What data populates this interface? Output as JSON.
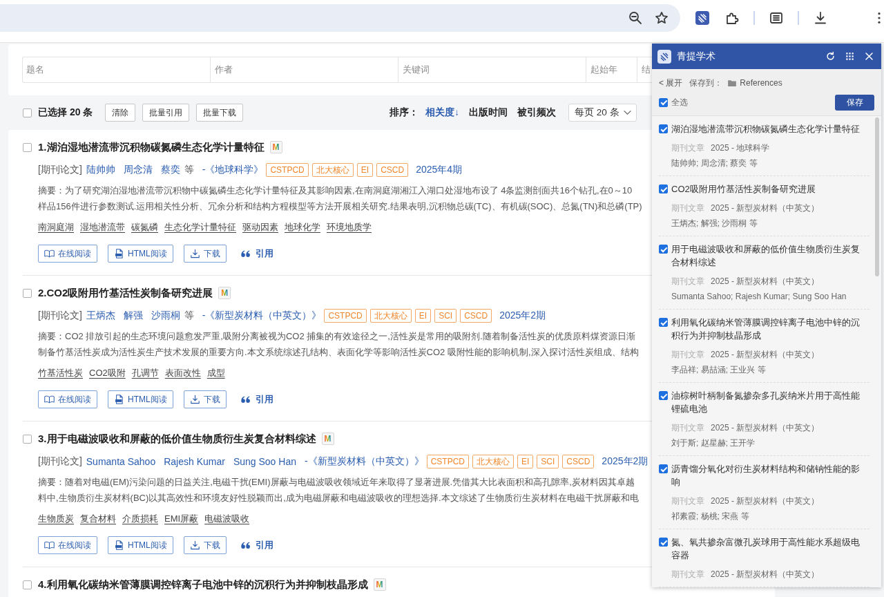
{
  "search_form": {
    "fields": [
      {
        "kind": "text",
        "placeholder": "题名"
      },
      {
        "kind": "text",
        "placeholder": "作者"
      },
      {
        "kind": "text",
        "placeholder": "关键词"
      },
      {
        "kind": "year",
        "placeholder": "起始年"
      },
      {
        "kind": "year",
        "placeholder": "结"
      }
    ]
  },
  "toolbar": {
    "select_all": {
      "checked": false,
      "label": "已选择 20 条"
    },
    "buttons": [
      "清除",
      "批量引用",
      "批量下载"
    ],
    "sort_label": "排序：",
    "sort_options": [
      {
        "label": "相关度↓",
        "selected": true
      },
      {
        "label": "出版时间",
        "selected": false
      },
      {
        "label": "被引频次",
        "selected": false
      }
    ],
    "page_size": "每页 20 条"
  },
  "results": [
    {
      "selected": false,
      "title": "1.湖泊湿地潜流带沉积物碳氮磷生态化学计量特征",
      "badge": "M",
      "type": "[期刊论文]",
      "authors": [
        "陆帅帅",
        "周念清",
        "蔡奕"
      ],
      "et_al": "等",
      "journal": "-《地球科学》",
      "tags": [
        "CSTPCD",
        "北大核心",
        "EI",
        "CSCD"
      ],
      "issue": "2025年4期",
      "abstract": [
        "摘要：为了研究湖泊湿地潜流带沉积物中碳氮磷生态化学计量特征及其影响因素,在南洞庭湖湘江入湖口处湿地布设了 4条监测剖面共16个钻孔,在0～10",
        "样品156件进行参数测试.运用相关性分析、冗余分析和结构方程模型等方法开展相关研究.结果表明,沉积物总碳(TC)、有机碳(SOC)、总氮(TN)和总磷(TP)"
      ],
      "keywords": [
        "南洞庭湖",
        "湿地潜流带",
        "碳氮磷",
        "生态化学计量特征",
        "驱动因素",
        "地球化学",
        "环境地质学"
      ],
      "actions": [
        {
          "kind": "read",
          "label": "在线阅读"
        },
        {
          "kind": "html",
          "label": "HTML阅读"
        },
        {
          "kind": "download",
          "label": "下载"
        },
        {
          "kind": "cite",
          "label": "引用"
        }
      ]
    },
    {
      "selected": false,
      "title": "2.CO2吸附用竹基活性炭制备研究进展",
      "badge": "M",
      "type": "[期刊论文]",
      "authors": [
        "王炳杰",
        "解强",
        "沙雨桐"
      ],
      "et_al": "等",
      "journal": "-《新型炭材料（中英文）》",
      "tags": [
        "CSTPCD",
        "北大核心",
        "EI",
        "SCI",
        "CSCD"
      ],
      "issue": "2025年2期",
      "abstract": [
        "摘要：CO2 排放引起的生态环境问题愈发严重,吸附分离被视为CO2 捕集的有效途径之一,活性炭是常用的吸附剂.随着制备活性炭的优质原料煤资源日渐",
        "制备竹基活性炭成为活性炭生产技术发展的重要方向.本文系统综述孔结构、表面化学等影响活性炭CO2 吸附性能的影响机制,深入探讨活性炭组成、结构"
      ],
      "keywords": [
        "竹基活性炭",
        "CO2吸附",
        "孔调节",
        "表面改性",
        "成型"
      ],
      "actions": [
        {
          "kind": "read",
          "label": "在线阅读"
        },
        {
          "kind": "html",
          "label": "HTML阅读"
        },
        {
          "kind": "download",
          "label": "下载"
        },
        {
          "kind": "cite",
          "label": "引用"
        }
      ]
    },
    {
      "selected": false,
      "title": "3.用于电磁波吸收和屏蔽的低价值生物质衍生炭复合材料综述",
      "badge": "M",
      "type": "[期刊论文]",
      "authors": [
        "Sumanta Sahoo",
        "Rajesh Kumar",
        "Sung Soo Han"
      ],
      "journal": "-《新型炭材料（中英文）》",
      "tags": [
        "CSTPCD",
        "北大核心",
        "EI",
        "SCI",
        "CSCD"
      ],
      "issue": "2025年2期",
      "abstract": [
        "摘要：随着对电磁(EM)污染问题的日益关注,电磁干扰(EMI)屏蔽与电磁波吸收领域近年来取得了显著进展.凭借其大比表面积和高孔隙率,炭材料因其卓越",
        "料中,生物质衍生炭材料(BC)以其高效性和环境友好性脱颖而出,成为电磁屏蔽和电磁波吸收的理想选择.本文综述了生物质衍生炭材料在电磁干扰屏蔽和电"
      ],
      "keywords": [
        "生物质炭",
        "复合材料",
        "介质损耗",
        "EMI屏蔽",
        "电磁波吸收"
      ],
      "actions": [
        {
          "kind": "read",
          "label": "在线阅读"
        },
        {
          "kind": "html",
          "label": "HTML阅读"
        },
        {
          "kind": "download",
          "label": "下载"
        },
        {
          "kind": "cite",
          "label": "引用"
        }
      ]
    },
    {
      "selected": false,
      "title": "4.利用氧化碳纳米管薄膜调控锌离子电池中锌的沉积行为并抑制枝晶形成",
      "badge": "M"
    }
  ],
  "panel": {
    "title": "青提学术",
    "expand": "< 展开",
    "save_to_label": "保存到：",
    "folder": "References",
    "select_all": {
      "label": "全选",
      "checked": true
    },
    "save_button": "保存",
    "items": [
      {
        "checked": true,
        "title": "湖泊湿地潜流带沉积物碳氮磷生态化学计量特征",
        "type": "期刊文章",
        "source": "2025 - 地球科学",
        "authors": "陆帅帅; 周念清; 蔡奕 等"
      },
      {
        "checked": true,
        "title": "CO2吸附用竹基活性炭制备研究进展",
        "type": "期刊文章",
        "source": "2025 - 新型炭材料（中英文）",
        "authors": "王炳杰; 解强; 沙雨桐 等"
      },
      {
        "checked": true,
        "title": "用于电磁波吸收和屏蔽的低价值生物质衍生炭复合材料综述",
        "type": "期刊文章",
        "source": "2025 - 新型炭材料（中英文）",
        "authors": "Sumanta Sahoo; Rajesh Kumar; Sung Soo Han"
      },
      {
        "checked": true,
        "title": "利用氧化碳纳米管薄膜调控锌离子电池中锌的沉积行为并抑制枝晶形成",
        "type": "期刊文章",
        "source": "2025 - 新型炭材料（中英文）",
        "authors": "李品祥; 易喆涵; 王业兴 等"
      },
      {
        "checked": true,
        "title": "油棕树叶柄制备氮掺杂多孔炭纳米片用于高性能锂硫电池",
        "type": "期刊文章",
        "source": "2025 - 新型炭材料（中英文）",
        "authors": "刘于斯; 赵星赫; 王开学"
      },
      {
        "checked": true,
        "title": "沥青馏分氧化对衍生炭材料结构和储钠性能的影响",
        "type": "期刊文章",
        "source": "2025 - 新型炭材料（中英文）",
        "authors": "祁素霞; 杨桃; 宋燕 等"
      },
      {
        "checked": true,
        "title": "氮、氧共掺杂富微孔炭球用于高性能水系超级电容器",
        "type": "期刊文章",
        "source": "2025 - 新型炭材料（中英文）"
      }
    ]
  }
}
